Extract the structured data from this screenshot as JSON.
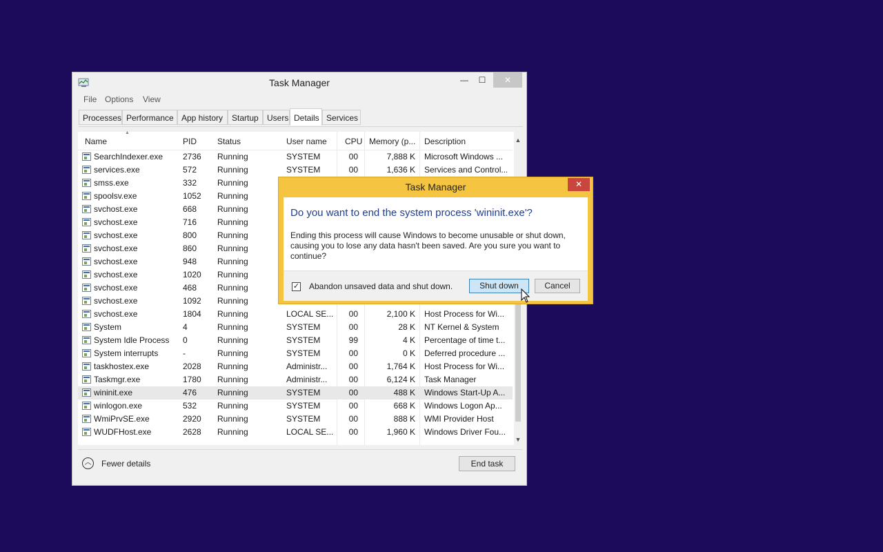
{
  "window": {
    "title": "Task Manager",
    "controls": {
      "minimize": "—",
      "maximize": "☐",
      "close": "✕"
    }
  },
  "menu": [
    "File",
    "Options",
    "View"
  ],
  "tabs": [
    {
      "label": "Processes",
      "active": false
    },
    {
      "label": "Performance",
      "active": false
    },
    {
      "label": "App history",
      "active": false
    },
    {
      "label": "Startup",
      "active": false
    },
    {
      "label": "Users",
      "active": false
    },
    {
      "label": "Details",
      "active": true
    },
    {
      "label": "Services",
      "active": false
    }
  ],
  "columns": {
    "name": "Name",
    "pid": "PID",
    "status": "Status",
    "user": "User name",
    "cpu": "CPU",
    "memory": "Memory (p...",
    "description": "Description"
  },
  "rows": [
    {
      "name": "SearchIndexer.exe",
      "pid": "2736",
      "status": "Running",
      "user": "SYSTEM",
      "cpu": "00",
      "mem": "7,888 K",
      "desc": "Microsoft Windows ..."
    },
    {
      "name": "services.exe",
      "pid": "572",
      "status": "Running",
      "user": "SYSTEM",
      "cpu": "00",
      "mem": "1,636 K",
      "desc": "Services and Control..."
    },
    {
      "name": "smss.exe",
      "pid": "332",
      "status": "Running",
      "user": "",
      "cpu": "",
      "mem": "",
      "desc": ""
    },
    {
      "name": "spoolsv.exe",
      "pid": "1052",
      "status": "Running",
      "user": "",
      "cpu": "",
      "mem": "",
      "desc": ""
    },
    {
      "name": "svchost.exe",
      "pid": "668",
      "status": "Running",
      "user": "",
      "cpu": "",
      "mem": "",
      "desc": ""
    },
    {
      "name": "svchost.exe",
      "pid": "716",
      "status": "Running",
      "user": "",
      "cpu": "",
      "mem": "",
      "desc": ""
    },
    {
      "name": "svchost.exe",
      "pid": "800",
      "status": "Running",
      "user": "",
      "cpu": "",
      "mem": "",
      "desc": ""
    },
    {
      "name": "svchost.exe",
      "pid": "860",
      "status": "Running",
      "user": "",
      "cpu": "",
      "mem": "",
      "desc": ""
    },
    {
      "name": "svchost.exe",
      "pid": "948",
      "status": "Running",
      "user": "",
      "cpu": "",
      "mem": "",
      "desc": ""
    },
    {
      "name": "svchost.exe",
      "pid": "1020",
      "status": "Running",
      "user": "",
      "cpu": "",
      "mem": "",
      "desc": ""
    },
    {
      "name": "svchost.exe",
      "pid": "468",
      "status": "Running",
      "user": "",
      "cpu": "",
      "mem": "",
      "desc": ""
    },
    {
      "name": "svchost.exe",
      "pid": "1092",
      "status": "Running",
      "user": "",
      "cpu": "",
      "mem": "",
      "desc": ""
    },
    {
      "name": "svchost.exe",
      "pid": "1804",
      "status": "Running",
      "user": "LOCAL SE...",
      "cpu": "00",
      "mem": "2,100 K",
      "desc": "Host Process for Wi..."
    },
    {
      "name": "System",
      "pid": "4",
      "status": "Running",
      "user": "SYSTEM",
      "cpu": "00",
      "mem": "28 K",
      "desc": "NT Kernel & System"
    },
    {
      "name": "System Idle Process",
      "pid": "0",
      "status": "Running",
      "user": "SYSTEM",
      "cpu": "99",
      "mem": "4 K",
      "desc": "Percentage of time t..."
    },
    {
      "name": "System interrupts",
      "pid": "-",
      "status": "Running",
      "user": "SYSTEM",
      "cpu": "00",
      "mem": "0 K",
      "desc": "Deferred procedure ..."
    },
    {
      "name": "taskhostex.exe",
      "pid": "2028",
      "status": "Running",
      "user": "Administr...",
      "cpu": "00",
      "mem": "1,764 K",
      "desc": "Host Process for Wi..."
    },
    {
      "name": "Taskmgr.exe",
      "pid": "1780",
      "status": "Running",
      "user": "Administr...",
      "cpu": "00",
      "mem": "6,124 K",
      "desc": "Task Manager"
    },
    {
      "name": "wininit.exe",
      "pid": "476",
      "status": "Running",
      "user": "SYSTEM",
      "cpu": "00",
      "mem": "488 K",
      "desc": "Windows Start-Up A...",
      "selected": true
    },
    {
      "name": "winlogon.exe",
      "pid": "532",
      "status": "Running",
      "user": "SYSTEM",
      "cpu": "00",
      "mem": "668 K",
      "desc": "Windows Logon Ap..."
    },
    {
      "name": "WmiPrvSE.exe",
      "pid": "2920",
      "status": "Running",
      "user": "SYSTEM",
      "cpu": "00",
      "mem": "888 K",
      "desc": "WMI Provider Host"
    },
    {
      "name": "WUDFHost.exe",
      "pid": "2628",
      "status": "Running",
      "user": "LOCAL SE...",
      "cpu": "00",
      "mem": "1,960 K",
      "desc": "Windows Driver Fou..."
    }
  ],
  "footer": {
    "fewer_details": "Fewer details",
    "end_task": "End task"
  },
  "dialog": {
    "title": "Task Manager",
    "close": "✕",
    "heading": "Do you want to end the system process 'wininit.exe'?",
    "message": "Ending this process will cause Windows to become unusable or shut down, causing you to lose any data hasn't been saved. Are you sure you want to continue?",
    "checkbox_label": "Abandon unsaved data and shut down.",
    "checkbox_checked": true,
    "checkmark": "✓",
    "primary_button": "Shut down",
    "secondary_button": "Cancel"
  },
  "icons": {
    "fewer_details": "chevron-up-circle-icon",
    "scroll_up": "▲",
    "scroll_down": "▼",
    "fewer_glyph": "︿"
  },
  "colors": {
    "desktop": "#1c0a5a",
    "dialog_accent": "#f5c542",
    "heading_blue": "#1f3d8c",
    "close_red": "#c9463d"
  }
}
